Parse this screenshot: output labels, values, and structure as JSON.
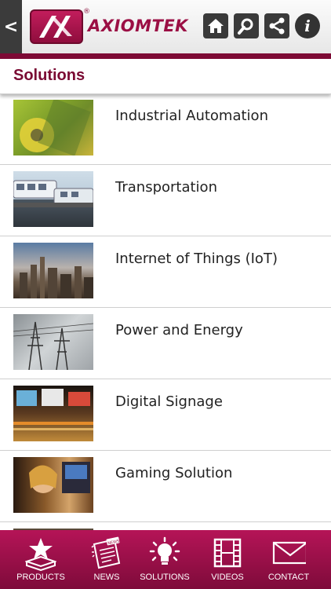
{
  "header": {
    "logo_text": "AXIOMTEK",
    "logo_reg": "®",
    "back_glyph": "<",
    "buttons": [
      "home-icon",
      "search-icon",
      "share-icon",
      "info-icon"
    ]
  },
  "page": {
    "title": "Solutions"
  },
  "solutions": [
    {
      "label": "Industrial Automation"
    },
    {
      "label": "Transportation"
    },
    {
      "label": "Internet of Things (IoT)"
    },
    {
      "label": "Power and Energy"
    },
    {
      "label": "Digital Signage"
    },
    {
      "label": "Gaming Solution"
    },
    {
      "label": ""
    }
  ],
  "nav": [
    {
      "label": "PRODUCTS"
    },
    {
      "label": "NEWS",
      "badge": "NEWS"
    },
    {
      "label": "SOLUTIONS"
    },
    {
      "label": "VIDEOS"
    },
    {
      "label": "CONTACT"
    }
  ],
  "colors": {
    "brand": "#9b0f44",
    "header_bar": "#7d0a35",
    "nav_top": "#b51457",
    "nav_bottom": "#7e0b3a"
  }
}
